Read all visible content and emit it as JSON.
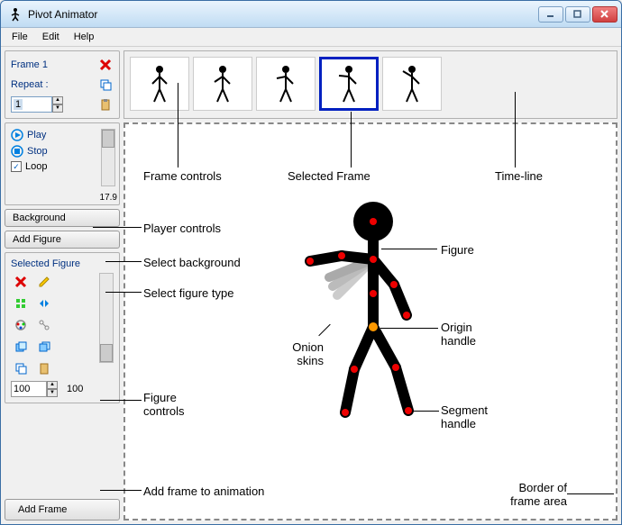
{
  "window": {
    "title": "Pivot Animator"
  },
  "menu": {
    "file": "File",
    "edit": "Edit",
    "help": "Help"
  },
  "framePanel": {
    "frameLabel": "Frame 1",
    "repeatLabel": "Repeat :",
    "repeatValue": "1"
  },
  "player": {
    "play": "Play",
    "stop": "Stop",
    "loop": "Loop",
    "fps": "17.9"
  },
  "buttons": {
    "background": "Background",
    "addFigure": "Add Figure",
    "addFrame": "Add Frame"
  },
  "figurePanel": {
    "title": "Selected Figure",
    "scaleValue": "100",
    "scaleLabel": "100"
  },
  "annotations": {
    "frameControls": "Frame controls",
    "selectedFrame": "Selected Frame",
    "timeline": "Time-line",
    "playerControls": "Player controls",
    "selectBackground": "Select background",
    "selectFigureType": "Select figure type",
    "figureControls": "Figure controls",
    "addFrameAnim": "Add frame to animation",
    "figure": "Figure",
    "originHandle": "Origin handle",
    "segmentHandle": "Segment handle",
    "onionSkins": "Onion skins",
    "borderFrameArea": "Border of frame area"
  }
}
